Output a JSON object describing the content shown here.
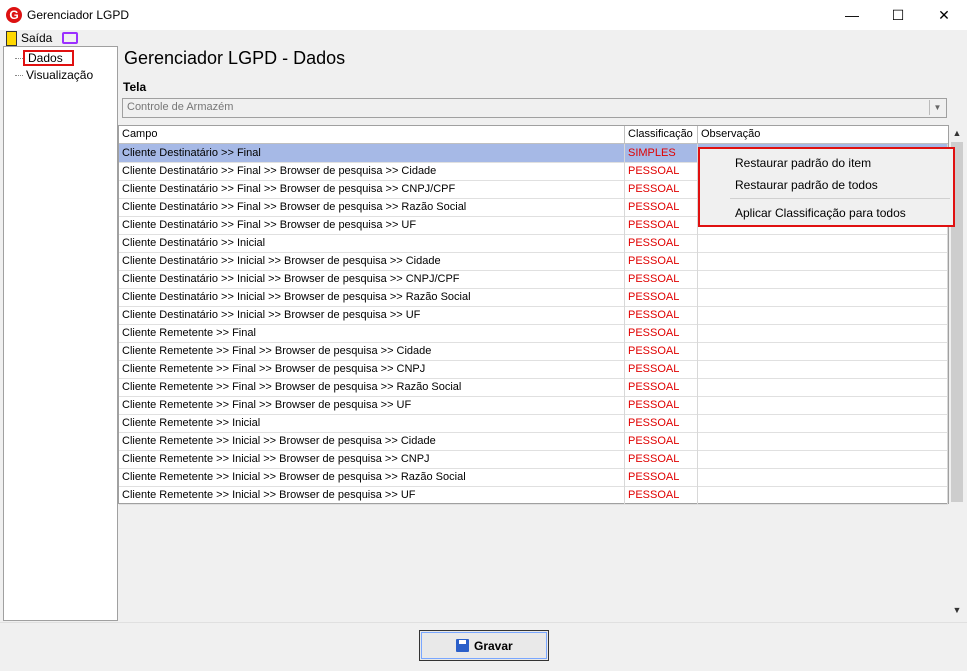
{
  "window": {
    "title": "Gerenciador LGPD",
    "minimize": "—",
    "maximize": "☐",
    "close": "✕"
  },
  "toolbar": {
    "exit_label": "Saída"
  },
  "tree": {
    "items": [
      "Dados",
      "Visualização"
    ]
  },
  "page": {
    "title": "Gerenciador LGPD - Dados"
  },
  "tela": {
    "label": "Tela",
    "value": "Controle de Armazém"
  },
  "grid": {
    "headers": [
      "Campo",
      "Classificação",
      "Observação"
    ],
    "rows": [
      {
        "campo": "Cliente Destinatário >> Final",
        "classificacao": "SIMPLES",
        "observacao": ""
      },
      {
        "campo": "Cliente Destinatário >> Final >> Browser de pesquisa >> Cidade",
        "classificacao": "PESSOAL",
        "observacao": ""
      },
      {
        "campo": "Cliente Destinatário >> Final >> Browser de pesquisa >> CNPJ/CPF",
        "classificacao": "PESSOAL",
        "observacao": ""
      },
      {
        "campo": "Cliente Destinatário >> Final >> Browser de pesquisa >> Razão Social",
        "classificacao": "PESSOAL",
        "observacao": ""
      },
      {
        "campo": "Cliente Destinatário >> Final >> Browser de pesquisa >> UF",
        "classificacao": "PESSOAL",
        "observacao": ""
      },
      {
        "campo": "Cliente Destinatário >> Inicial",
        "classificacao": "PESSOAL",
        "observacao": ""
      },
      {
        "campo": "Cliente Destinatário >> Inicial >> Browser de pesquisa >> Cidade",
        "classificacao": "PESSOAL",
        "observacao": ""
      },
      {
        "campo": "Cliente Destinatário >> Inicial >> Browser de pesquisa >> CNPJ/CPF",
        "classificacao": "PESSOAL",
        "observacao": ""
      },
      {
        "campo": "Cliente Destinatário >> Inicial >> Browser de pesquisa >> Razão Social",
        "classificacao": "PESSOAL",
        "observacao": ""
      },
      {
        "campo": "Cliente Destinatário >> Inicial >> Browser de pesquisa >> UF",
        "classificacao": "PESSOAL",
        "observacao": ""
      },
      {
        "campo": "Cliente Remetente >> Final",
        "classificacao": "PESSOAL",
        "observacao": ""
      },
      {
        "campo": "Cliente Remetente >> Final >> Browser de pesquisa >> Cidade",
        "classificacao": "PESSOAL",
        "observacao": ""
      },
      {
        "campo": "Cliente Remetente >> Final >> Browser de pesquisa >> CNPJ",
        "classificacao": "PESSOAL",
        "observacao": ""
      },
      {
        "campo": "Cliente Remetente >> Final >> Browser de pesquisa >> Razão Social",
        "classificacao": "PESSOAL",
        "observacao": ""
      },
      {
        "campo": "Cliente Remetente >> Final >> Browser de pesquisa >> UF",
        "classificacao": "PESSOAL",
        "observacao": ""
      },
      {
        "campo": "Cliente Remetente >> Inicial",
        "classificacao": "PESSOAL",
        "observacao": ""
      },
      {
        "campo": "Cliente Remetente >> Inicial >> Browser de pesquisa >> Cidade",
        "classificacao": "PESSOAL",
        "observacao": ""
      },
      {
        "campo": "Cliente Remetente >> Inicial >> Browser de pesquisa >> CNPJ",
        "classificacao": "PESSOAL",
        "observacao": ""
      },
      {
        "campo": "Cliente Remetente >> Inicial >> Browser de pesquisa >> Razão Social",
        "classificacao": "PESSOAL",
        "observacao": ""
      },
      {
        "campo": "Cliente Remetente >> Inicial >> Browser de pesquisa >> UF",
        "classificacao": "PESSOAL",
        "observacao": ""
      }
    ]
  },
  "context_menu": {
    "items": [
      "Restaurar padrão do item",
      "Restaurar padrão de todos",
      "Aplicar Classificação para todos"
    ]
  },
  "footer": {
    "save_label": "Gravar"
  },
  "colors": {
    "classification": "#e00000",
    "selected_row": "#a6b9e6",
    "highlight_border": "#e01010"
  },
  "icons": [
    "app-logo-icon",
    "exit-door-icon",
    "monitor-icon",
    "save-disk-icon"
  ]
}
